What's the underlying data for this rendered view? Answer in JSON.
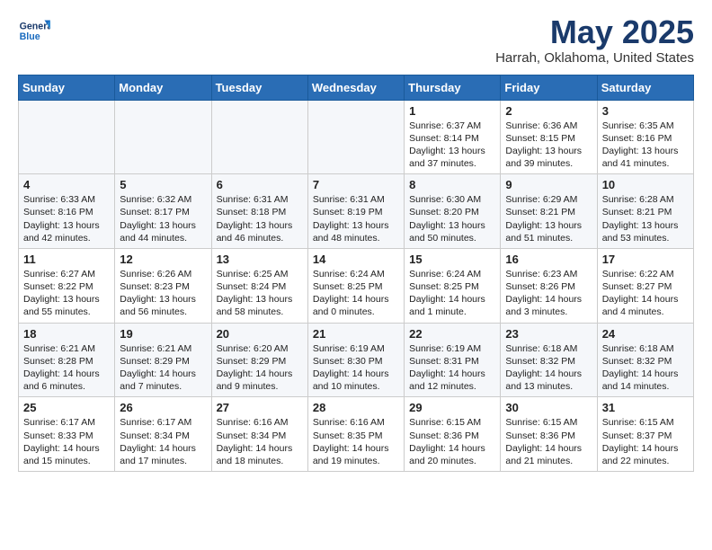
{
  "header": {
    "logo_line1": "General",
    "logo_line2": "Blue",
    "month": "May 2025",
    "location": "Harrah, Oklahoma, United States"
  },
  "days_of_week": [
    "Sunday",
    "Monday",
    "Tuesday",
    "Wednesday",
    "Thursday",
    "Friday",
    "Saturday"
  ],
  "weeks": [
    [
      {
        "day": "",
        "info": ""
      },
      {
        "day": "",
        "info": ""
      },
      {
        "day": "",
        "info": ""
      },
      {
        "day": "",
        "info": ""
      },
      {
        "day": "1",
        "info": "Sunrise: 6:37 AM\nSunset: 8:14 PM\nDaylight: 13 hours\nand 37 minutes."
      },
      {
        "day": "2",
        "info": "Sunrise: 6:36 AM\nSunset: 8:15 PM\nDaylight: 13 hours\nand 39 minutes."
      },
      {
        "day": "3",
        "info": "Sunrise: 6:35 AM\nSunset: 8:16 PM\nDaylight: 13 hours\nand 41 minutes."
      }
    ],
    [
      {
        "day": "4",
        "info": "Sunrise: 6:33 AM\nSunset: 8:16 PM\nDaylight: 13 hours\nand 42 minutes."
      },
      {
        "day": "5",
        "info": "Sunrise: 6:32 AM\nSunset: 8:17 PM\nDaylight: 13 hours\nand 44 minutes."
      },
      {
        "day": "6",
        "info": "Sunrise: 6:31 AM\nSunset: 8:18 PM\nDaylight: 13 hours\nand 46 minutes."
      },
      {
        "day": "7",
        "info": "Sunrise: 6:31 AM\nSunset: 8:19 PM\nDaylight: 13 hours\nand 48 minutes."
      },
      {
        "day": "8",
        "info": "Sunrise: 6:30 AM\nSunset: 8:20 PM\nDaylight: 13 hours\nand 50 minutes."
      },
      {
        "day": "9",
        "info": "Sunrise: 6:29 AM\nSunset: 8:21 PM\nDaylight: 13 hours\nand 51 minutes."
      },
      {
        "day": "10",
        "info": "Sunrise: 6:28 AM\nSunset: 8:21 PM\nDaylight: 13 hours\nand 53 minutes."
      }
    ],
    [
      {
        "day": "11",
        "info": "Sunrise: 6:27 AM\nSunset: 8:22 PM\nDaylight: 13 hours\nand 55 minutes."
      },
      {
        "day": "12",
        "info": "Sunrise: 6:26 AM\nSunset: 8:23 PM\nDaylight: 13 hours\nand 56 minutes."
      },
      {
        "day": "13",
        "info": "Sunrise: 6:25 AM\nSunset: 8:24 PM\nDaylight: 13 hours\nand 58 minutes."
      },
      {
        "day": "14",
        "info": "Sunrise: 6:24 AM\nSunset: 8:25 PM\nDaylight: 14 hours\nand 0 minutes."
      },
      {
        "day": "15",
        "info": "Sunrise: 6:24 AM\nSunset: 8:25 PM\nDaylight: 14 hours\nand 1 minute."
      },
      {
        "day": "16",
        "info": "Sunrise: 6:23 AM\nSunset: 8:26 PM\nDaylight: 14 hours\nand 3 minutes."
      },
      {
        "day": "17",
        "info": "Sunrise: 6:22 AM\nSunset: 8:27 PM\nDaylight: 14 hours\nand 4 minutes."
      }
    ],
    [
      {
        "day": "18",
        "info": "Sunrise: 6:21 AM\nSunset: 8:28 PM\nDaylight: 14 hours\nand 6 minutes."
      },
      {
        "day": "19",
        "info": "Sunrise: 6:21 AM\nSunset: 8:29 PM\nDaylight: 14 hours\nand 7 minutes."
      },
      {
        "day": "20",
        "info": "Sunrise: 6:20 AM\nSunset: 8:29 PM\nDaylight: 14 hours\nand 9 minutes."
      },
      {
        "day": "21",
        "info": "Sunrise: 6:19 AM\nSunset: 8:30 PM\nDaylight: 14 hours\nand 10 minutes."
      },
      {
        "day": "22",
        "info": "Sunrise: 6:19 AM\nSunset: 8:31 PM\nDaylight: 14 hours\nand 12 minutes."
      },
      {
        "day": "23",
        "info": "Sunrise: 6:18 AM\nSunset: 8:32 PM\nDaylight: 14 hours\nand 13 minutes."
      },
      {
        "day": "24",
        "info": "Sunrise: 6:18 AM\nSunset: 8:32 PM\nDaylight: 14 hours\nand 14 minutes."
      }
    ],
    [
      {
        "day": "25",
        "info": "Sunrise: 6:17 AM\nSunset: 8:33 PM\nDaylight: 14 hours\nand 15 minutes."
      },
      {
        "day": "26",
        "info": "Sunrise: 6:17 AM\nSunset: 8:34 PM\nDaylight: 14 hours\nand 17 minutes."
      },
      {
        "day": "27",
        "info": "Sunrise: 6:16 AM\nSunset: 8:34 PM\nDaylight: 14 hours\nand 18 minutes."
      },
      {
        "day": "28",
        "info": "Sunrise: 6:16 AM\nSunset: 8:35 PM\nDaylight: 14 hours\nand 19 minutes."
      },
      {
        "day": "29",
        "info": "Sunrise: 6:15 AM\nSunset: 8:36 PM\nDaylight: 14 hours\nand 20 minutes."
      },
      {
        "day": "30",
        "info": "Sunrise: 6:15 AM\nSunset: 8:36 PM\nDaylight: 14 hours\nand 21 minutes."
      },
      {
        "day": "31",
        "info": "Sunrise: 6:15 AM\nSunset: 8:37 PM\nDaylight: 14 hours\nand 22 minutes."
      }
    ]
  ]
}
